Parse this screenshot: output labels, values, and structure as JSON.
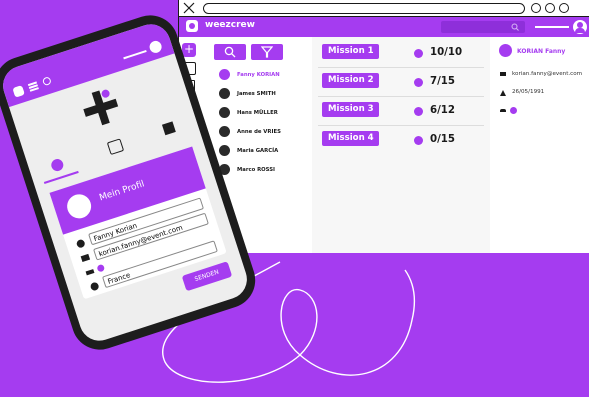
{
  "app": {
    "name": "weezcrew"
  },
  "users": [
    {
      "name": "Fanny KORIAN",
      "active": true
    },
    {
      "name": "James SMITH"
    },
    {
      "name": "Hans MÜLLER"
    },
    {
      "name": "Anne de VRIES"
    },
    {
      "name": "Maria GARCÍA"
    },
    {
      "name": "Marco ROSSI"
    }
  ],
  "missions": [
    {
      "label": "Mission 1",
      "count": "10/10"
    },
    {
      "label": "Mission 2",
      "count": "7/15"
    },
    {
      "label": "Mission 3",
      "count": "6/12"
    },
    {
      "label": "Mission 4",
      "count": "0/15"
    }
  ],
  "detail": {
    "name": "KORIAN Fanny",
    "email": "korian.fanny@event.com",
    "birthdate": "26/05/1991"
  },
  "phone": {
    "profile_title": "Mein Profil",
    "name_value": "Fanny Korian",
    "email_value": "korian.fanny@event.com",
    "country_value": "France",
    "submit_label": "SENDEN"
  },
  "colors": {
    "accent": "#a53cf0",
    "dark": "#1a1a1a"
  }
}
